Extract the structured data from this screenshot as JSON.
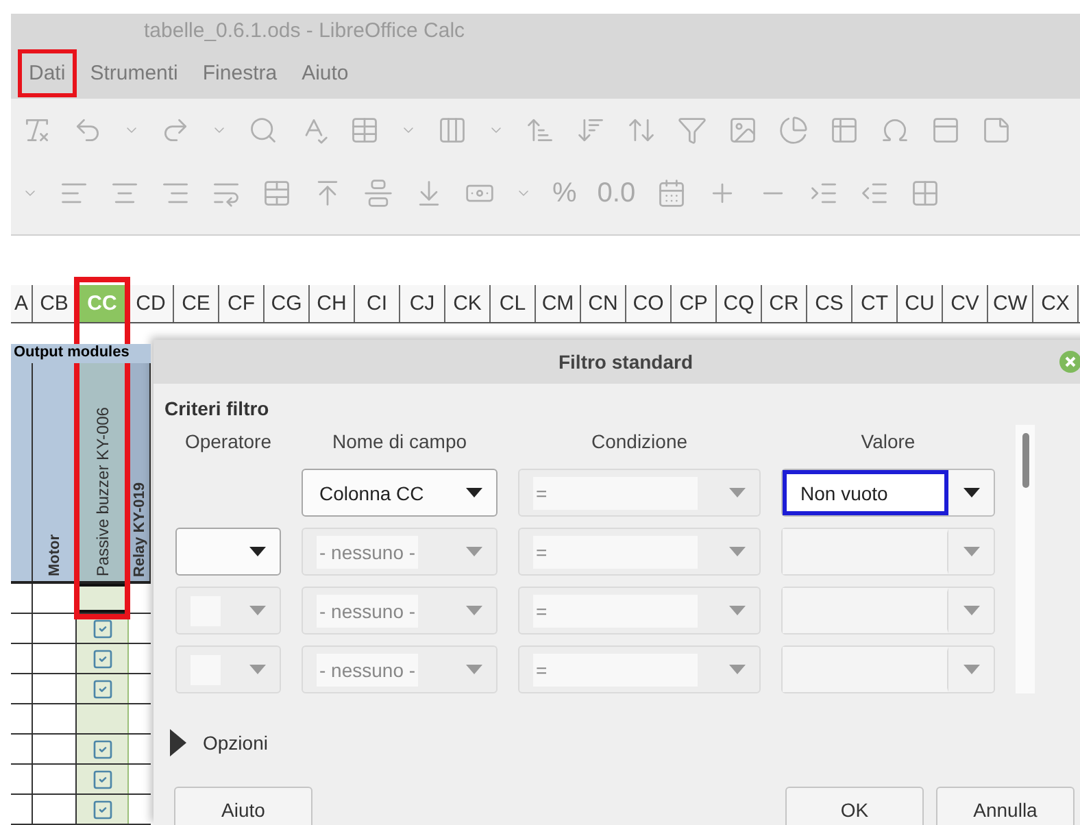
{
  "window": {
    "title": "tabelle_0.6.1.ods - LibreOffice Calc"
  },
  "menu": [
    {
      "label": "Dati",
      "marked": true
    },
    {
      "label": "Strumenti",
      "marked": false
    },
    {
      "label": "Finestra",
      "marked": false
    },
    {
      "label": "Aiuto",
      "marked": false
    }
  ],
  "format_toolbar": {
    "text_buttons": [
      "%",
      "0.0"
    ]
  },
  "columns": [
    {
      "label": "A",
      "selected": false,
      "marked": false
    },
    {
      "label": "CB",
      "selected": false,
      "marked": false
    },
    {
      "label": "CC",
      "selected": true,
      "marked": true
    },
    {
      "label": "CD",
      "selected": false,
      "marked": false
    },
    {
      "label": "CE",
      "selected": false,
      "marked": false
    },
    {
      "label": "CF",
      "selected": false,
      "marked": false
    },
    {
      "label": "CG",
      "selected": false,
      "marked": false
    },
    {
      "label": "CH",
      "selected": false,
      "marked": false
    },
    {
      "label": "CI",
      "selected": false,
      "marked": false
    },
    {
      "label": "CJ",
      "selected": false,
      "marked": false
    },
    {
      "label": "CK",
      "selected": false,
      "marked": false
    },
    {
      "label": "CL",
      "selected": false,
      "marked": false
    },
    {
      "label": "CM",
      "selected": false,
      "marked": false
    },
    {
      "label": "CN",
      "selected": false,
      "marked": false
    },
    {
      "label": "CO",
      "selected": false,
      "marked": false
    },
    {
      "label": "CP",
      "selected": false,
      "marked": false
    },
    {
      "label": "CQ",
      "selected": false,
      "marked": false
    },
    {
      "label": "CR",
      "selected": false,
      "marked": false
    },
    {
      "label": "CS",
      "selected": false,
      "marked": false
    },
    {
      "label": "CT",
      "selected": false,
      "marked": false
    },
    {
      "label": "CU",
      "selected": false,
      "marked": false
    },
    {
      "label": "CV",
      "selected": false,
      "marked": false
    },
    {
      "label": "CW",
      "selected": false,
      "marked": false
    },
    {
      "label": "CX",
      "selected": false,
      "marked": false
    }
  ],
  "sheet": {
    "group_header": "Output modules",
    "headers": [
      "Motor",
      "Passive buzzer KY-006",
      "Relay KY-019"
    ],
    "buzzer_cells": [
      {
        "checked": false,
        "selected": true
      },
      {
        "checked": true,
        "selected": false
      },
      {
        "checked": true,
        "selected": false
      },
      {
        "checked": true,
        "selected": false
      },
      {
        "checked": false,
        "selected": false
      },
      {
        "checked": true,
        "selected": false
      },
      {
        "checked": true,
        "selected": false
      },
      {
        "checked": true,
        "selected": false
      }
    ]
  },
  "dialog": {
    "title": "Filtro standard",
    "section": "Criteri filtro",
    "column_labels": [
      "Operatore",
      "Nome di campo",
      "Condizione",
      "Valore"
    ],
    "criteria": [
      {
        "operator_shown": false,
        "field": "Colonna CC",
        "field_disabled": false,
        "condition": "=",
        "value": "Non vuoto",
        "value_disabled": false,
        "value_marked": true
      },
      {
        "operator_shown": true,
        "operator_disabled": false,
        "field": "- nessuno -",
        "field_disabled": true,
        "condition": "=",
        "value_disabled": true,
        "value_marked": false
      },
      {
        "operator_shown": true,
        "operator_disabled": true,
        "field": "- nessuno -",
        "field_disabled": true,
        "condition": "=",
        "value_disabled": true,
        "value_marked": false
      },
      {
        "operator_shown": true,
        "operator_disabled": true,
        "field": "- nessuno -",
        "field_disabled": true,
        "condition": "=",
        "value_disabled": true,
        "value_marked": false
      }
    ],
    "options": {
      "label": "Opzioni",
      "expanded": false
    },
    "buttons": {
      "help": "Aiuto",
      "ok": "OK",
      "cancel": "Annulla"
    }
  }
}
